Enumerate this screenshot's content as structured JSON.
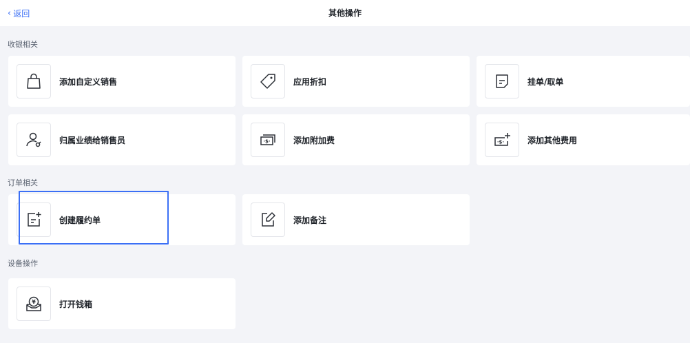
{
  "header": {
    "back_label": "返回",
    "title": "其他操作"
  },
  "sections": [
    {
      "title": "收银相关",
      "items": [
        {
          "label": "添加自定义销售",
          "icon": "shopping-bag-icon"
        },
        {
          "label": "应用折扣",
          "icon": "tag-icon"
        },
        {
          "label": "挂单/取单",
          "icon": "document-icon"
        },
        {
          "label": "归属业绩给销售员",
          "icon": "user-assign-icon"
        },
        {
          "label": "添加附加费",
          "icon": "money-stack-icon"
        },
        {
          "label": "添加其他费用",
          "icon": "money-plus-icon"
        }
      ]
    },
    {
      "title": "订单相关",
      "items": [
        {
          "label": "创建履约单",
          "icon": "document-add-icon"
        },
        {
          "label": "添加备注",
          "icon": "edit-note-icon"
        }
      ]
    },
    {
      "title": "设备操作",
      "items": [
        {
          "label": "打开钱箱",
          "icon": "cash-drawer-icon"
        }
      ]
    }
  ],
  "colors": {
    "accent": "#3b6ff5",
    "background": "#f3f4f8",
    "card": "#ffffff"
  }
}
